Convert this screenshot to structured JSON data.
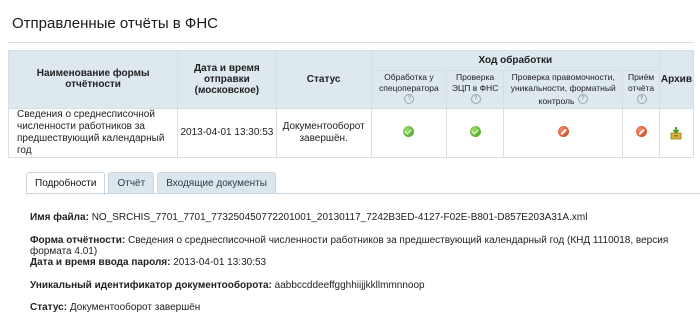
{
  "page": {
    "title": "Отправленные отчёты в ФНС"
  },
  "table": {
    "headers": {
      "form_name": "Наименование формы отчётности",
      "sent_at": "Дата и время отправки (московское)",
      "status": "Статус",
      "progress": "Ход обработки",
      "archive": "Архив"
    },
    "progress_columns": [
      "Обработка у спецоператора",
      "Проверка ЭЦП в ФНС",
      "Проверка правомочности, уникальности, форматный контроль",
      "Приём отчёта"
    ],
    "help_glyph": "?",
    "rows": [
      {
        "form_name": "Сведения о среднесписочной численности работников за предшествующий календарный год",
        "sent_at": "2013-04-01 13:30:53",
        "status": "Документооборот завершён.",
        "progress": [
          "ok",
          "ok",
          "error",
          "error"
        ],
        "archive_icon": "archive-download-icon"
      }
    ]
  },
  "tabs": [
    {
      "label": "Подробности",
      "active": true
    },
    {
      "label": "Отчёт",
      "active": false
    },
    {
      "label": "Входящие документы",
      "active": false
    }
  ],
  "details": {
    "file_name_label": "Имя файла:",
    "file_name_value": "NO_SRCHIS_7701_7701_773250450772201001_20130117_7242B3ED-4127-F02E-B801-D857E203A31A.xml",
    "form_label": "Форма отчётности:",
    "form_value": "Сведения о среднесписочной численности работников за предшествующий календарный год (КНД 1110018, версия формата 4.01)",
    "password_label": "Дата и время ввода пароля:",
    "password_value": "2013-04-01 13:30:53",
    "uid_label": "Уникальный идентификатор документооборота:",
    "uid_value": "aabbccddeeffgghhiijjkkllmmnnoop",
    "status_label": "Статус:",
    "status_value": "Документооборот завершён"
  },
  "colors": {
    "header_bg": "#dde8ef",
    "ok": "#3d9b1c",
    "error": "#c8391a"
  }
}
